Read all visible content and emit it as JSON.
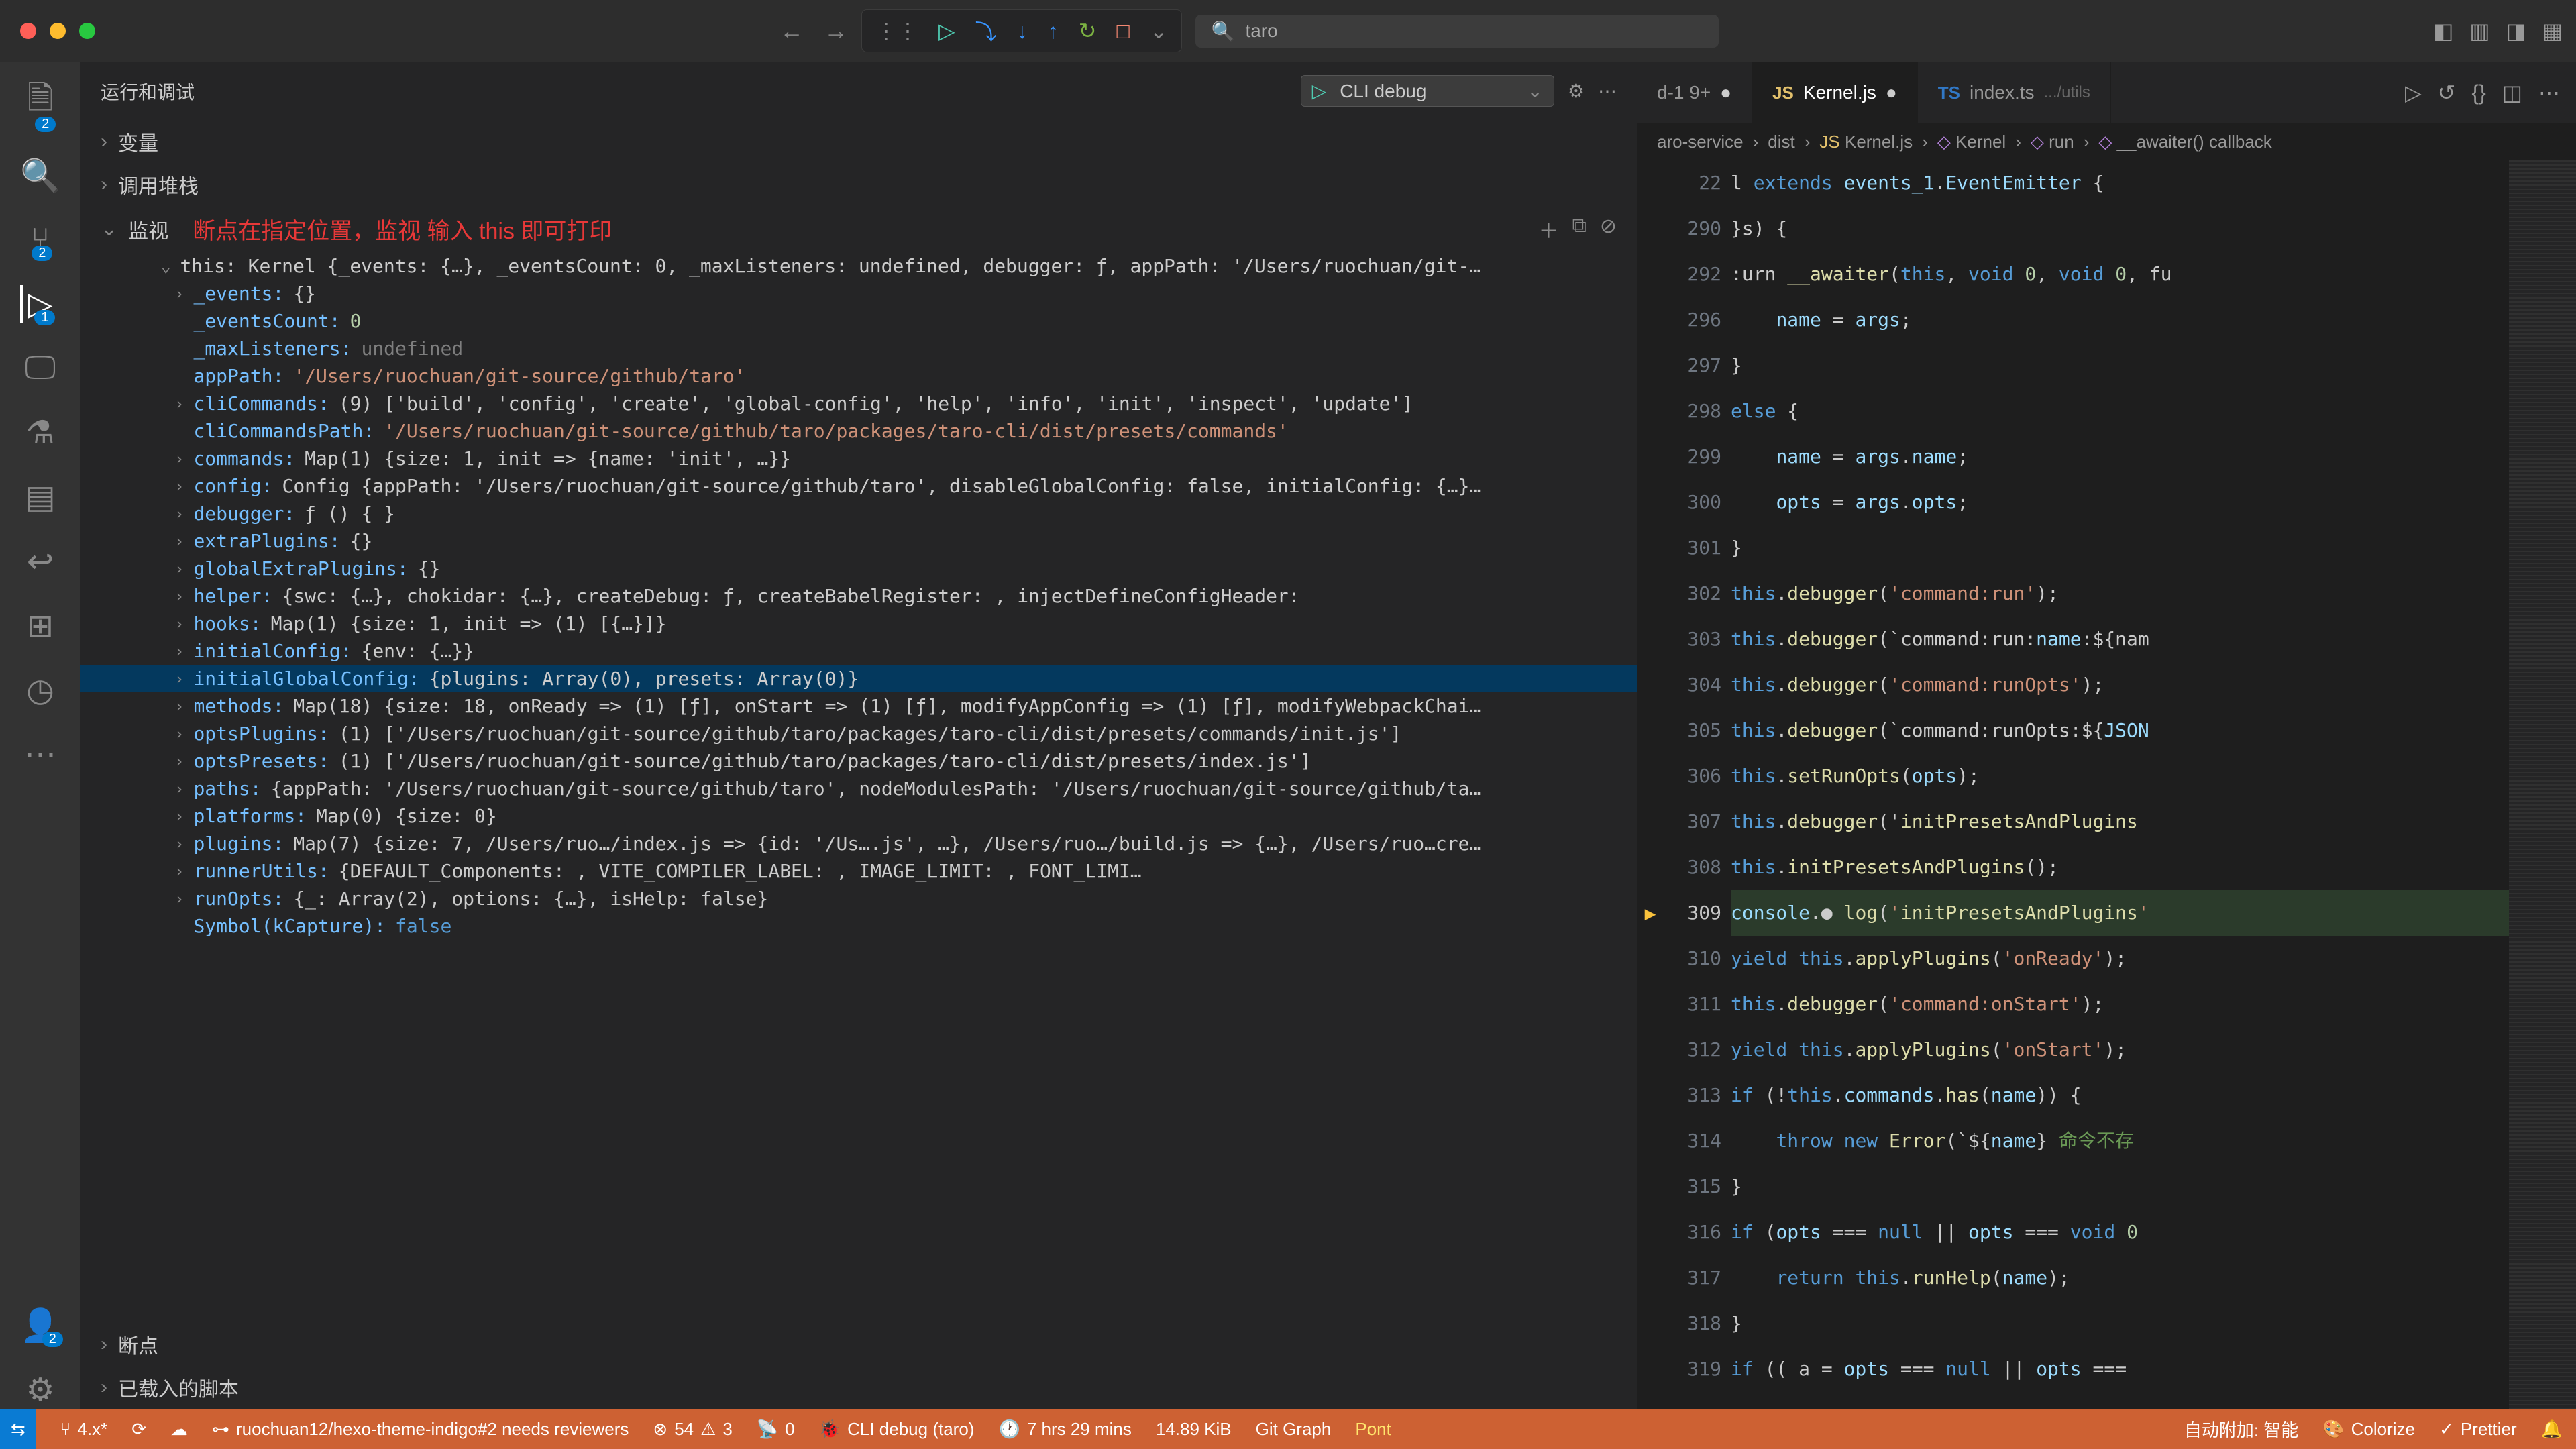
{
  "titlebar": {
    "search": "taro"
  },
  "debug_toolbar": {
    "continue": "▷",
    "step_over": "⤵",
    "step_into": "↓",
    "step_out": "↑",
    "restart": "↻",
    "stop": "□"
  },
  "activity_badges": {
    "explorer": "2",
    "scm": "2",
    "debug": "1",
    "accounts": "2"
  },
  "sidebar": {
    "title": "运行和调试",
    "config": "CLI debug",
    "sections": {
      "variables": "变量",
      "callstack": "调用堆栈",
      "watch": "监视",
      "breakpoints": "断点",
      "loaded": "已载入的脚本"
    },
    "annotation": "断点在指定位置，监视 输入 this 即可打印"
  },
  "watch": {
    "top": "this: Kernel {_events: {…}, _eventsCount: 0, _maxListeners: undefined, debugger: ƒ, appPath: '/Users/ruochuan/git-…",
    "rows": [
      {
        "k": "_events",
        "v": "{}",
        "t": "obj",
        "chev": true
      },
      {
        "k": "_eventsCount",
        "v": "0",
        "t": "num",
        "chev": false
      },
      {
        "k": "_maxListeners",
        "v": "undefined",
        "t": "undef",
        "chev": false
      },
      {
        "k": "appPath",
        "v": "'/Users/ruochuan/git-source/github/taro'",
        "t": "str",
        "chev": false
      },
      {
        "k": "cliCommands",
        "v": "(9) ['build', 'config', 'create', 'global-config', 'help', 'info', 'init', 'inspect', 'update']",
        "t": "obj",
        "chev": true
      },
      {
        "k": "cliCommandsPath",
        "v": "'/Users/ruochuan/git-source/github/taro/packages/taro-cli/dist/presets/commands'",
        "t": "str",
        "chev": false
      },
      {
        "k": "commands",
        "v": "Map(1) {size: 1, init => {name: 'init', …}}",
        "t": "obj",
        "chev": true
      },
      {
        "k": "config",
        "v": "Config {appPath: '/Users/ruochuan/git-source/github/taro', disableGlobalConfig: false, initialConfig: {…}…",
        "t": "obj",
        "chev": true
      },
      {
        "k": "debugger",
        "v": "ƒ () { }",
        "t": "obj",
        "chev": true
      },
      {
        "k": "extraPlugins",
        "v": "{}",
        "t": "obj",
        "chev": true
      },
      {
        "k": "globalExtraPlugins",
        "v": "{}",
        "t": "obj",
        "chev": true
      },
      {
        "k": "helper",
        "v": "{swc: {…}, chokidar: {…}, createDebug: ƒ, createBabelRegister: <accessor>, injectDefineConfigHeader: <acc…",
        "t": "obj",
        "chev": true
      },
      {
        "k": "hooks",
        "v": "Map(1) {size: 1, init => (1) [{…}]}",
        "t": "obj",
        "chev": true
      },
      {
        "k": "initialConfig",
        "v": "{env: {…}}",
        "t": "obj",
        "chev": true
      },
      {
        "k": "initialGlobalConfig",
        "v": "{plugins: Array(0), presets: Array(0)}",
        "t": "obj",
        "chev": true,
        "sel": true
      },
      {
        "k": "methods",
        "v": "Map(18) {size: 18, onReady => (1) [ƒ], onStart => (1) [ƒ], modifyAppConfig => (1) [ƒ], modifyWebpackChai…",
        "t": "obj",
        "chev": true
      },
      {
        "k": "optsPlugins",
        "v": "(1) ['/Users/ruochuan/git-source/github/taro/packages/taro-cli/dist/presets/commands/init.js']",
        "t": "obj",
        "chev": true
      },
      {
        "k": "optsPresets",
        "v": "(1) ['/Users/ruochuan/git-source/github/taro/packages/taro-cli/dist/presets/index.js']",
        "t": "obj",
        "chev": true
      },
      {
        "k": "paths",
        "v": "{appPath: '/Users/ruochuan/git-source/github/taro', nodeModulesPath: '/Users/ruochuan/git-source/github/ta…",
        "t": "obj",
        "chev": true
      },
      {
        "k": "platforms",
        "v": "Map(0) {size: 0}",
        "t": "obj",
        "chev": true
      },
      {
        "k": "plugins",
        "v": "Map(7) {size: 7, /Users/ruo…/index.js => {id: '/Us….js', …}, /Users/ruo…/build.js => {…}, /Users/ruo…cre…",
        "t": "obj",
        "chev": true
      },
      {
        "k": "runnerUtils",
        "v": "{DEFAULT_Components: <accessor>, VITE_COMPILER_LABEL: <accessor>, IMAGE_LIMIT: <accessor>, FONT_LIMI…",
        "t": "obj",
        "chev": true
      },
      {
        "k": "runOpts",
        "v": "{_: Array(2), options: {…}, isHelp: false}",
        "t": "obj",
        "chev": true
      },
      {
        "k": "Symbol(kCapture)",
        "v": "false",
        "t": "bool",
        "chev": false
      }
    ]
  },
  "tabs": [
    {
      "label": "d-1 9+",
      "dirty": true,
      "type": "txt"
    },
    {
      "label": "Kernel.js",
      "dirty": true,
      "type": "js",
      "active": true
    },
    {
      "label": "index.ts",
      "hint": ".../utils",
      "type": "ts"
    }
  ],
  "breadcrumbs": [
    "aro-service",
    "dist",
    "Kernel.js",
    "Kernel",
    "run",
    "__awaiter() callback"
  ],
  "code": {
    "lines": [
      {
        "n": 22
      },
      {
        "n": 290
      },
      {
        "n": 292
      },
      {
        "n": 296
      },
      {
        "n": 297
      },
      {
        "n": 298
      },
      {
        "n": 299
      },
      {
        "n": 300
      },
      {
        "n": 301
      },
      {
        "n": 302
      },
      {
        "n": 303
      },
      {
        "n": 304
      },
      {
        "n": 305
      },
      {
        "n": 306
      },
      {
        "n": 307
      },
      {
        "n": 308
      },
      {
        "n": 309,
        "bp": true,
        "hl": true
      },
      {
        "n": 310
      },
      {
        "n": 311
      },
      {
        "n": 312
      },
      {
        "n": 313
      },
      {
        "n": 314
      },
      {
        "n": 315
      },
      {
        "n": 316
      },
      {
        "n": 317
      },
      {
        "n": 318
      },
      {
        "n": 319
      }
    ],
    "src": {
      "l22": "l extends events_1.EventEmitter {",
      "l290": "}s) {",
      "l292": ":urn __awaiter(this, void 0, void 0, fu",
      "l296": "    name = args;",
      "l297": "}",
      "l298": "else {",
      "l299": "    name = args.name;",
      "l300": "    opts = args.opts;",
      "l301": "}",
      "l302": "this.debugger('command:run');",
      "l303": "this.debugger(`command:run:name:${nam",
      "l304": "this.debugger('command:runOpts');",
      "l305": "this.debugger(`command:runOpts:${JSON",
      "l306": "this.setRunOpts(opts);",
      "l307": "this.debugger('initPresetsAndPlugins",
      "l308": "this.initPresetsAndPlugins();",
      "l309": "console.● log('initPresetsAndPlugins'",
      "l310": "yield this.applyPlugins('onReady');",
      "l311": "this.debugger('command:onStart');",
      "l312": "yield this.applyPlugins('onStart');",
      "l313": "if (!this.commands.has(name)) {",
      "l314": "    throw new Error(`${name} 命令不存",
      "l315": "}",
      "l316": "if (opts === null || opts === void 0",
      "l317": "    return this.runHelp(name);",
      "l318": "}",
      "l319": "if (( a = opts === null || opts ==="
    }
  },
  "status": {
    "branch": "4.x*",
    "pr": "ruochuan12/hexo-theme-indigo#2 needs reviewers",
    "errors": "54",
    "warnings": "3",
    "ports": "0",
    "debug": "CLI debug (taro)",
    "time": "7 hrs 29 mins",
    "size": "14.89 KiB",
    "git_graph": "Git Graph",
    "pont": "Pont",
    "auto_attach": "自动附加: 智能",
    "colorize": "Colorize",
    "prettier": "Prettier"
  }
}
